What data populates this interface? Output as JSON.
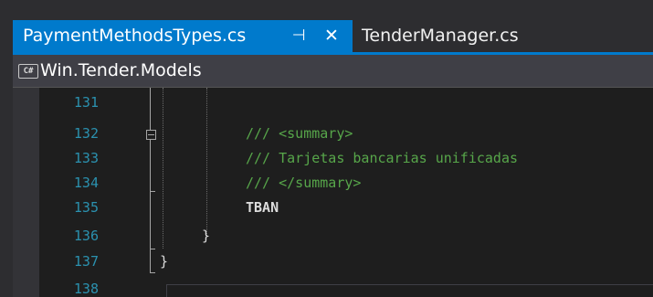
{
  "tabs": [
    {
      "label": "PaymentMethodsTypes.cs",
      "active": true,
      "pin_glyph": "⊣",
      "close_glyph": "✕"
    },
    {
      "label": "TenderManager.cs",
      "active": false
    }
  ],
  "navbar": {
    "icon_text": "C#",
    "label": "Win.Tender.Models"
  },
  "editor": {
    "lines": [
      {
        "number": "131",
        "text": ""
      },
      {
        "number": "132",
        "text": "/// <summary>"
      },
      {
        "number": "133",
        "text": "/// Tarjetas bancarias unificadas"
      },
      {
        "number": "134",
        "text": "/// </summary>"
      },
      {
        "number": "135",
        "text": "TBAN"
      },
      {
        "number": "136",
        "text": "}"
      },
      {
        "number": "137",
        "text": "}"
      },
      {
        "number": "138",
        "text": ""
      }
    ]
  },
  "colors": {
    "accent": "#007acc",
    "comment": "#57a64a",
    "line_number": "#2b91af",
    "background": "#1e1e1e"
  }
}
